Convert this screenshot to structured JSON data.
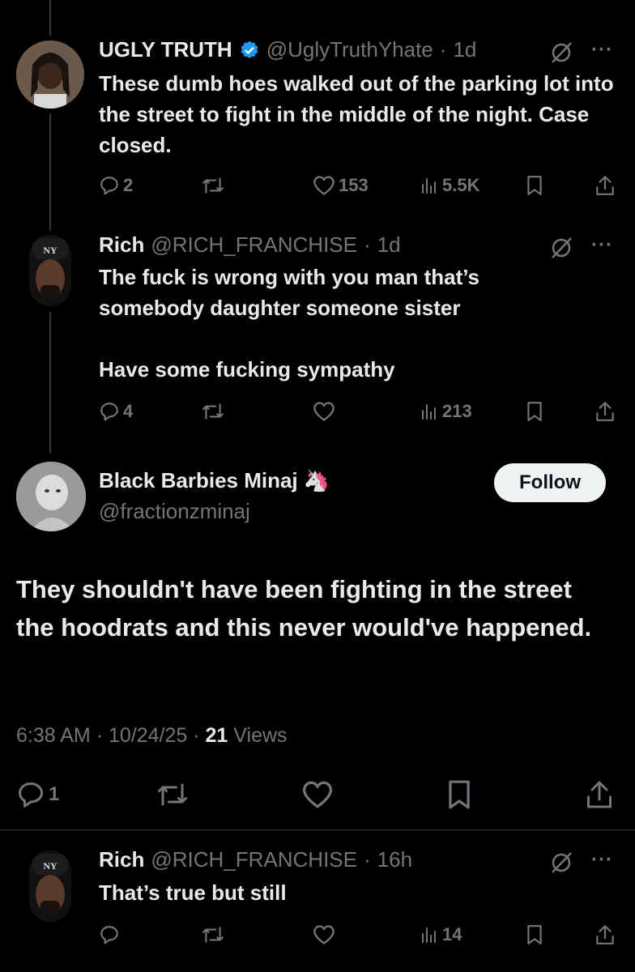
{
  "tweet1": {
    "name": "UGLY TRUTH",
    "handle": "@UglyTruthYhate",
    "sep": "·",
    "time": "1d",
    "text": "These dumb hoes walked out of the parking lot into the street to fight in the middle of the night. Case closed.",
    "replies": "2",
    "reposts": "",
    "likes": "153",
    "views": "5.5K"
  },
  "tweet2": {
    "name": "Rich",
    "handle": "@RICH_FRANCHISE",
    "sep": "·",
    "time": "1d",
    "text_line1": "The fuck is wrong with you man that’s somebody daughter someone sister",
    "text_line2": "Have some fucking sympathy",
    "replies": "4",
    "reposts": "",
    "likes": "",
    "views": "213"
  },
  "main": {
    "name": "Black Barbies Minaj",
    "emoji": "🦄",
    "handle": "@fractionzminaj",
    "follow_label": "Follow",
    "text": "They shouldn't have been fighting in the street the hoodrats and this never would've happened.",
    "time": "6:38 AM",
    "date": "10/24/25",
    "views_count": "21",
    "views_label": "Views",
    "replies": "1"
  },
  "tweet3": {
    "name": "Rich",
    "handle": "@RICH_FRANCHISE",
    "sep": "·",
    "time": "16h",
    "text": "That’s true but still",
    "views": "14"
  },
  "colors": {
    "background": "#000000",
    "text": "#e7e9ea",
    "secondary": "#71767b",
    "verified": "#1d9bf0"
  },
  "icons": [
    "reply-icon",
    "repost-icon",
    "like-icon",
    "views-icon",
    "bookmark-icon",
    "share-icon",
    "more-icon",
    "grok-icon",
    "verified-badge-icon"
  ]
}
